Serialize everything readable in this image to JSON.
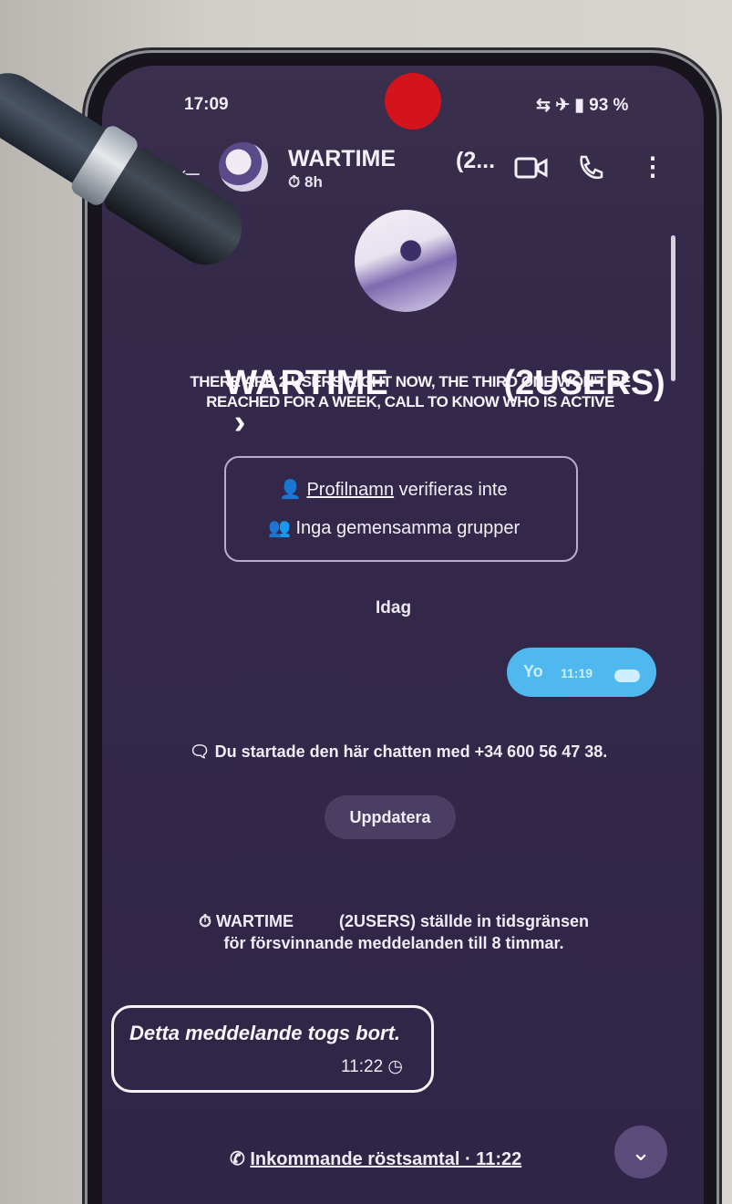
{
  "status_bar": {
    "time": "17:09",
    "battery": "93 %"
  },
  "header": {
    "title": "WARTIME",
    "timer": "8h",
    "title_extra": "(2..."
  },
  "profile": {
    "name": "WARTIME            (2USERS)",
    "description": "THERE ARE 2 USERS RIGHT NOW, THE THIRD ONE WON'T BE REACHED FOR A WEEK, CALL TO KNOW WHO IS ACTIVE",
    "verify_label": "Profilnamn",
    "verify_suffix": " verifieras inte",
    "groups_label": "Inga gemensamma grupper"
  },
  "chat": {
    "date_label": "Idag",
    "sent_message": "Yo",
    "sent_time": "11:19",
    "started_notice": "Du startade den här chatten med +34 600 56 47 38.",
    "update_button": "Uppdatera",
    "timer_notice_line1": "WARTIME          (2USERS) ställde in tidsgränsen",
    "timer_notice_line2": "för försvinnande meddelanden till 8 timmar.",
    "deleted_message": "Detta meddelande togs bort.",
    "deleted_time": "11:22",
    "call_notice": "Inkommande röstsamtal · 11:22"
  },
  "icons": {
    "back": "arrow-left-icon",
    "video": "video-icon",
    "phone": "phone-icon",
    "menu": "more-vert-icon",
    "scroll_down": "chevron-down-icon"
  },
  "colors": {
    "screen_bg": "#33284a",
    "bubble": "#4fb8ef",
    "notch_marker": "#d4141c"
  }
}
